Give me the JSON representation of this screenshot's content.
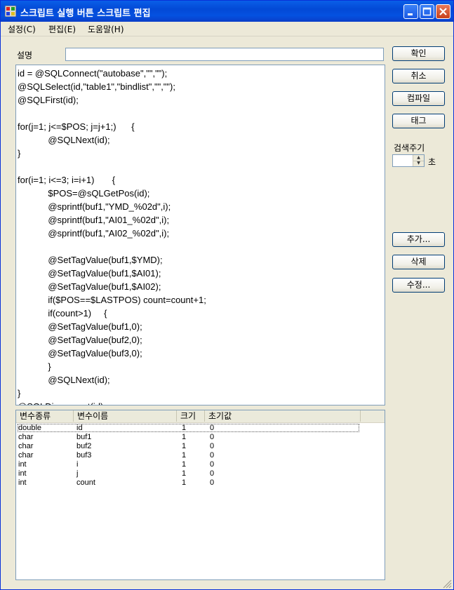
{
  "window": {
    "title": "스크립트 실행 버튼 스크립트 편집"
  },
  "menu": [
    "설정(C)",
    "편집(E)",
    "도움말(H)"
  ],
  "form": {
    "desc_label": "설명",
    "desc_value": ""
  },
  "buttons": {
    "ok": "확인",
    "cancel": "취소",
    "compile": "컴파일",
    "tag": "태그",
    "add": "추가...",
    "delete": "삭제",
    "edit": "수정..."
  },
  "search": {
    "label": "검색주기",
    "value": "",
    "unit": "초"
  },
  "code_lines": [
    "id = @SQLConnect(\"autobase\",\"\",\"\");",
    "@SQLSelect(id,\"table1\",\"bindlist\",\"\",\"\");",
    "@SQLFirst(id);",
    "",
    "for(j=1; j<=$POS; j=j+1;)      {",
    "            @SQLNext(id);",
    "}",
    "",
    "for(i=1; i<=3; i=i+1)       {",
    "            $POS=@sQLGetPos(id);",
    "            @sprintf(buf1,\"YMD_%02d\",i);",
    "            @sprintf(buf1,\"AI01_%02d\",i);",
    "            @sprintf(buf1,\"AI02_%02d\",i);",
    "",
    "            @SetTagValue(buf1,$YMD);",
    "            @SetTagValue(buf1,$AI01);",
    "            @SetTagValue(buf1,$AI02);",
    "            if($POS==$LASTPOS) count=count+1;",
    "            if(count>1)     {",
    "            @SetTagValue(buf1,0);",
    "            @SetTagValue(buf2,0);",
    "            @SetTagValue(buf3,0);",
    "            }",
    "            @SQLNext(id);",
    "}",
    "@SQLDisconnect(id);"
  ],
  "vars": {
    "columns": [
      "변수종류",
      "변수이름",
      "크기",
      "초기값"
    ],
    "rows": [
      [
        "double",
        "id",
        "1",
        "0"
      ],
      [
        "char",
        "buf1",
        "1",
        "0"
      ],
      [
        "char",
        "buf2",
        "1",
        "0"
      ],
      [
        "char",
        "buf3",
        "1",
        "0"
      ],
      [
        "int",
        "i",
        "1",
        "0"
      ],
      [
        "int",
        "j",
        "1",
        "0"
      ],
      [
        "int",
        "count",
        "1",
        "0"
      ]
    ]
  }
}
